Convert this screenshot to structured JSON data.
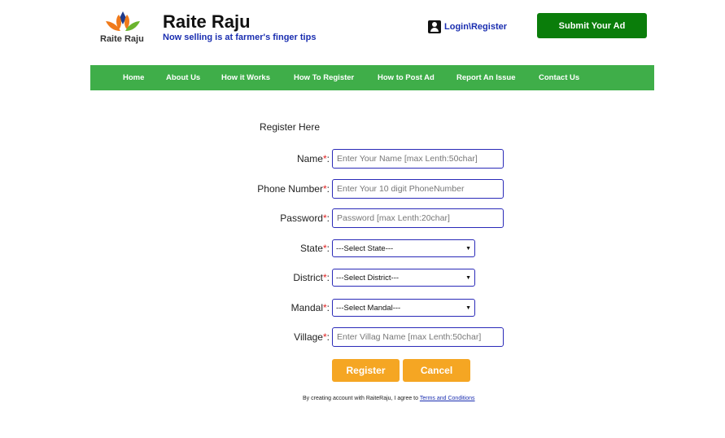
{
  "header": {
    "logo_text": "Raite Raju",
    "title": "Raite Raju",
    "tagline": "Now selling is at farmer's finger tips",
    "login_label": "Login\\Register",
    "submit_ad_label": "Submit Your Ad"
  },
  "nav": {
    "items": [
      "Home",
      "About Us",
      "How it Works",
      "How To Register",
      "How to Post Ad",
      "Report An Issue",
      "Contact Us"
    ]
  },
  "form": {
    "heading": "Register Here",
    "required_mark": "*",
    "fields": [
      {
        "label": "Name",
        "placeholder": "Enter Your Name [max Lenth:50char]"
      },
      {
        "label": "Phone Number",
        "placeholder": "Enter Your 10 digit PhoneNumber"
      },
      {
        "label": "Password",
        "placeholder": "Password [max Lenth:20char]"
      },
      {
        "label": "State",
        "selected": "---Select State---"
      },
      {
        "label": "District",
        "selected": "---Select District---"
      },
      {
        "label": "Mandal",
        "selected": "---Select Mandal---"
      },
      {
        "label": "Village",
        "placeholder": "Enter Villag Name [max Lenth:50char]"
      }
    ],
    "register_label": "Register",
    "cancel_label": "Cancel"
  },
  "terms": {
    "prefix": "By creating account with RaiteRaju, I agree to",
    "link": "Terms and Conditions"
  },
  "colors": {
    "nav_green": "#3fae49",
    "submit_green": "#0a7d0a",
    "button_orange": "#f5a623",
    "link_blue": "#1a2eb0",
    "required_red": "#e02020"
  }
}
